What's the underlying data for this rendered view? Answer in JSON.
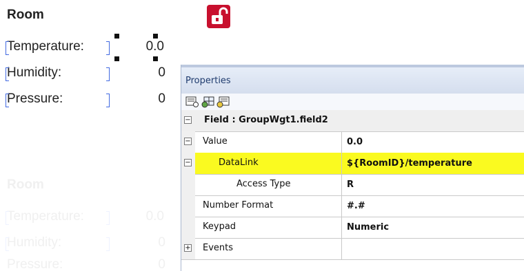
{
  "room": {
    "title": "Room",
    "rows": [
      {
        "label": "Temperature:",
        "value": "0.0"
      },
      {
        "label": "Humidity:",
        "value": "0"
      },
      {
        "label": "Pressure:",
        "value": "0"
      }
    ]
  },
  "ghost_room": {
    "title": "Room",
    "rows": [
      {
        "label": "Temperature:",
        "value": "0.0"
      },
      {
        "label": "Humidity:",
        "value": "0"
      },
      {
        "label": "Pressure:",
        "value": "0"
      }
    ]
  },
  "lock": {
    "icon": "unlock-icon",
    "color": "#c8102e"
  },
  "properties": {
    "title": "Properties",
    "toolbar": [
      "categorized-view-icon",
      "alphabetical-view-icon",
      "property-pages-icon"
    ],
    "category": {
      "label": "Field : GroupWgt1.field2",
      "expand": "−"
    },
    "rows": [
      {
        "name": "Value",
        "value": "0.0",
        "expand": "−"
      },
      {
        "name": "DataLink",
        "value": "${RoomID}/temperature",
        "expand": "−"
      },
      {
        "name": "Access Type",
        "value": "R"
      },
      {
        "name": "Number Format",
        "value": "#.#"
      },
      {
        "name": "Keypad",
        "value": "Numeric"
      },
      {
        "name": "Events",
        "value": "",
        "expand": "+"
      }
    ],
    "highlight_color": "#fafa20"
  }
}
